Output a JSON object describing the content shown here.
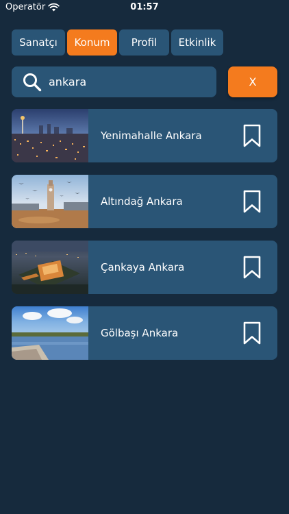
{
  "status_bar": {
    "carrier": "Operatör",
    "time": "01:57",
    "wifi_icon": "wifi-icon"
  },
  "tabs": [
    {
      "label": "Sanatçı",
      "active": false
    },
    {
      "label": "Konum",
      "active": true
    },
    {
      "label": "Profil",
      "active": false
    },
    {
      "label": "Etkinlik",
      "active": false
    }
  ],
  "search": {
    "value": "ankara",
    "icon": "search-icon",
    "clear_label": "X"
  },
  "results": [
    {
      "title": "Yenimahalle Ankara",
      "image": "city-skyline-night-photo",
      "icon": "bookmark-icon"
    },
    {
      "title": "Altındağ Ankara",
      "image": "clock-tower-square-photo",
      "icon": "bookmark-icon"
    },
    {
      "title": "Çankaya Ankara",
      "image": "mausoleum-aerial-night-photo",
      "icon": "bookmark-icon"
    },
    {
      "title": "Gölbaşı Ankara",
      "image": "lake-pier-photo",
      "icon": "bookmark-icon"
    }
  ],
  "colors": {
    "background": "#162a3d",
    "panel": "#2a5576",
    "accent": "#f47b1e",
    "text": "#ffffff"
  }
}
